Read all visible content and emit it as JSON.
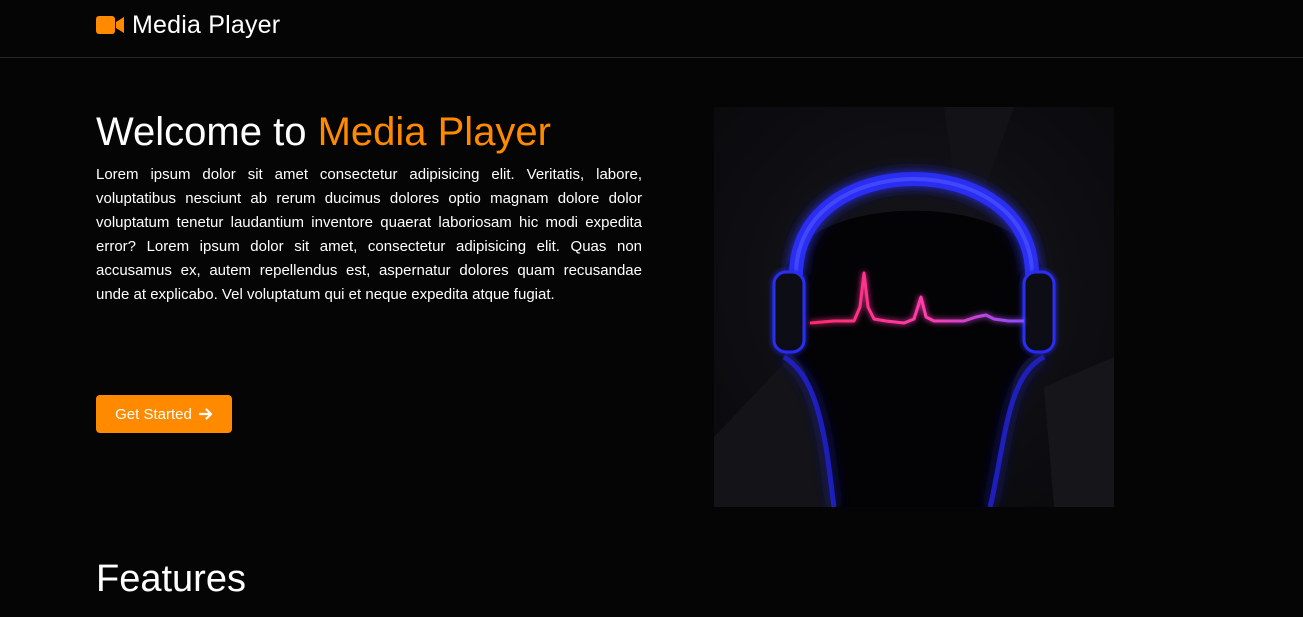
{
  "navbar": {
    "brand_label": "Media Player",
    "brand_icon": "video-camera-icon",
    "accent_color": "#ff8a00"
  },
  "hero": {
    "title_prefix": "Welcome to ",
    "title_accent": "Media Player",
    "body": "Lorem ipsum dolor sit amet consectetur adipisicing elit. Veritatis, labore, voluptatibus nesciunt ab rerum ducimus dolores optio magnam dolore dolor voluptatum tenetur laudantium inventore quaerat laboriosam hic modi expedita error? Lorem ipsum dolor sit amet, consectetur adipisicing elit. Quas non accusamus ex, autem repellendus est, aspernatur dolores quam recusandae unde at explicabo. Vel voluptatum qui et neque expedita atque fugiat.",
    "cta_label": "Get Started",
    "cta_icon": "arrow-right-icon",
    "image_subject": "headphones-waveform-illustration"
  },
  "features": {
    "title": "Features"
  }
}
